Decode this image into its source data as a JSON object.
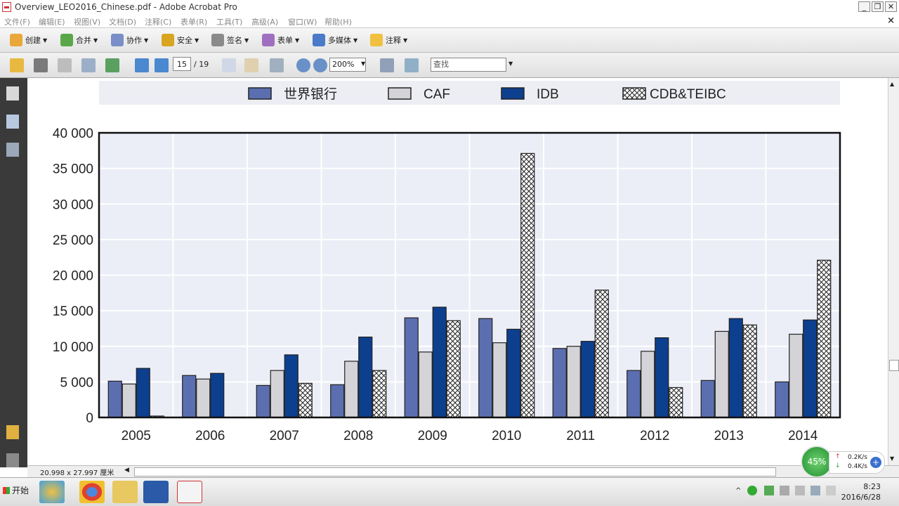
{
  "window": {
    "title": "Overview_LEO2016_Chinese.pdf - Adobe Acrobat Pro"
  },
  "menu": [
    "文件(F)",
    "编辑(E)",
    "视图(V)",
    "文档(D)",
    "注释(C)",
    "表单(R)",
    "工具(T)",
    "高级(A)",
    "窗口(W)",
    "帮助(H)"
  ],
  "toolbar": {
    "create": "创建",
    "combine": "合并",
    "collaborate": "协作",
    "secure": "安全",
    "sign": "签名",
    "forms": "表单",
    "multimedia": "多媒体",
    "comment": "注释"
  },
  "nav": {
    "page": "15",
    "total": "/ 19",
    "zoom": "200%",
    "find_placeholder": "查找"
  },
  "status": {
    "dimensions": "20.998 x 27.997 厘米"
  },
  "net": {
    "percent": "45%",
    "up": "0.2K/s",
    "down": "0.4K/s"
  },
  "taskbar": {
    "start": "开始",
    "time": "8:23",
    "date": "2016/6/28"
  },
  "colors": {
    "world_bank": "#5b6fb0",
    "caf": "#d4d4d8",
    "idb": "#0d3f8f",
    "grid_bg": "#eceef7"
  },
  "chart_data": {
    "type": "bar",
    "categories": [
      "2005",
      "2006",
      "2007",
      "2008",
      "2009",
      "2010",
      "2011",
      "2012",
      "2013",
      "2014"
    ],
    "series": [
      {
        "name": "世界银行",
        "values": [
          5100,
          5900,
          4500,
          4600,
          14000,
          13900,
          9700,
          6600,
          5200,
          5000
        ]
      },
      {
        "name": "CAF",
        "values": [
          4700,
          5400,
          6600,
          7900,
          9200,
          10500,
          10000,
          9300,
          12100,
          11700
        ]
      },
      {
        "name": "IDB",
        "values": [
          6900,
          6200,
          8800,
          11300,
          15500,
          12400,
          10700,
          11200,
          13900,
          13700
        ]
      },
      {
        "name": "CDB&TEIBC",
        "values": [
          200,
          0,
          4800,
          6600,
          13600,
          37100,
          17900,
          4200,
          13000,
          22100
        ]
      }
    ],
    "yticks": [
      "0",
      "5 000",
      "10 000",
      "15 000",
      "20 000",
      "25 000",
      "30 000",
      "35 000",
      "40 000"
    ],
    "ylim": [
      0,
      40000
    ],
    "grid": true,
    "legend": "top"
  }
}
